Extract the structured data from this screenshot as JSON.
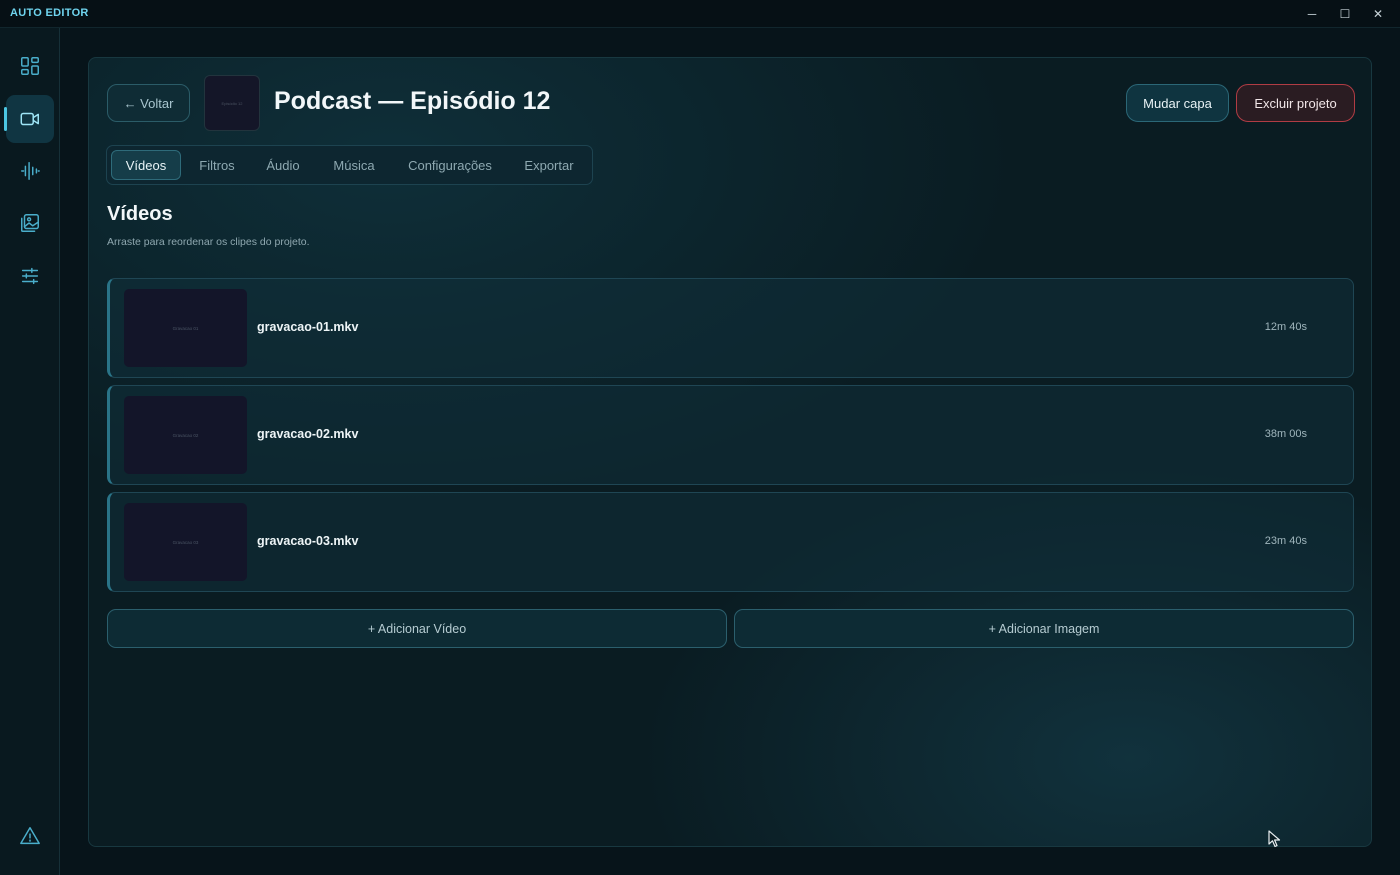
{
  "app": {
    "title": "AUTO EDITOR"
  },
  "window_controls": {
    "minimize": "─",
    "maximize": "☐",
    "close": "✕"
  },
  "sidebar": {
    "items": [
      {
        "icon": "dashboard-icon",
        "active": false
      },
      {
        "icon": "video-camera-icon",
        "active": true
      },
      {
        "icon": "audio-wave-icon",
        "active": false
      },
      {
        "icon": "image-gallery-icon",
        "active": false
      },
      {
        "icon": "sliders-icon",
        "active": false
      }
    ],
    "bottom_icon": "warning-icon"
  },
  "header": {
    "back_label": "← Voltar",
    "cover_thumb_text": "Episódio 12",
    "project_title": "Podcast — Episódio 12",
    "change_cover_label": "Mudar capa",
    "delete_label": "Excluir projeto"
  },
  "tabs": [
    {
      "label": "Vídeos",
      "active": true
    },
    {
      "label": "Filtros",
      "active": false
    },
    {
      "label": "Áudio",
      "active": false
    },
    {
      "label": "Música",
      "active": false
    },
    {
      "label": "Configurações",
      "active": false
    },
    {
      "label": "Exportar",
      "active": false
    }
  ],
  "section": {
    "title": "Vídeos",
    "subtitle": "Arraste para reordenar os clipes do projeto."
  },
  "clips": [
    {
      "thumb_text": "Gravacao 01",
      "name": "gravacao-01.mkv",
      "duration": "12m 40s"
    },
    {
      "thumb_text": "Gravacao 02",
      "name": "gravacao-02.mkv",
      "duration": "38m 00s"
    },
    {
      "thumb_text": "Gravacao 03",
      "name": "gravacao-03.mkv",
      "duration": "23m 40s"
    }
  ],
  "actions": {
    "add_video": "+ Adicionar Vídeo",
    "add_image": "+ Adicionar Imagem"
  },
  "colors": {
    "accent": "#4cc6e2",
    "danger": "#b03c44",
    "background": "#07141a"
  }
}
